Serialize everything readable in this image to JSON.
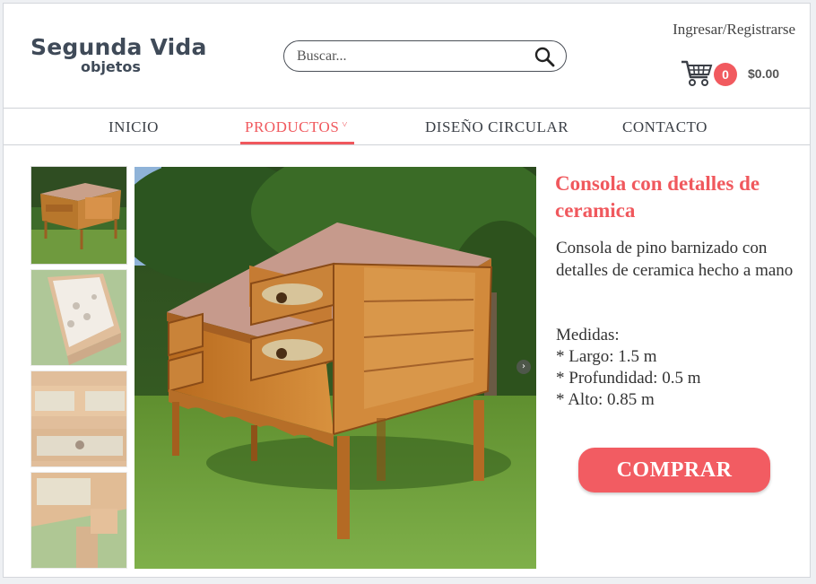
{
  "brand": {
    "name": "Segunda Vida",
    "tagline": "objetos"
  },
  "search": {
    "placeholder": "Buscar..."
  },
  "account": {
    "login_label": "Ingresar/Registrarse"
  },
  "cart": {
    "count": "0",
    "total": "$0.00",
    "icon": "shopping-cart-icon"
  },
  "nav": {
    "items": [
      {
        "label": "INICIO"
      },
      {
        "label": "PRODUCTOS",
        "caret": "˅",
        "active": true
      },
      {
        "label": "DISEÑO CIRCULAR"
      },
      {
        "label": "CONTACTO"
      }
    ]
  },
  "product": {
    "title": "Consola con detalles de ceramica",
    "description": "Consola de pino barnizado con detalles de ceramica hecho a mano",
    "measures_title": "Medidas:",
    "measures": [
      "* Largo: 1.5 m",
      "* Profundidad: 0.5 m",
      "* Alto: 0.85 m"
    ],
    "buy_label": "COMPRAR",
    "next_icon": "chevron-right-icon"
  },
  "colors": {
    "accent": "#f0585d",
    "text": "#333333",
    "logo": "#3f4a58"
  }
}
